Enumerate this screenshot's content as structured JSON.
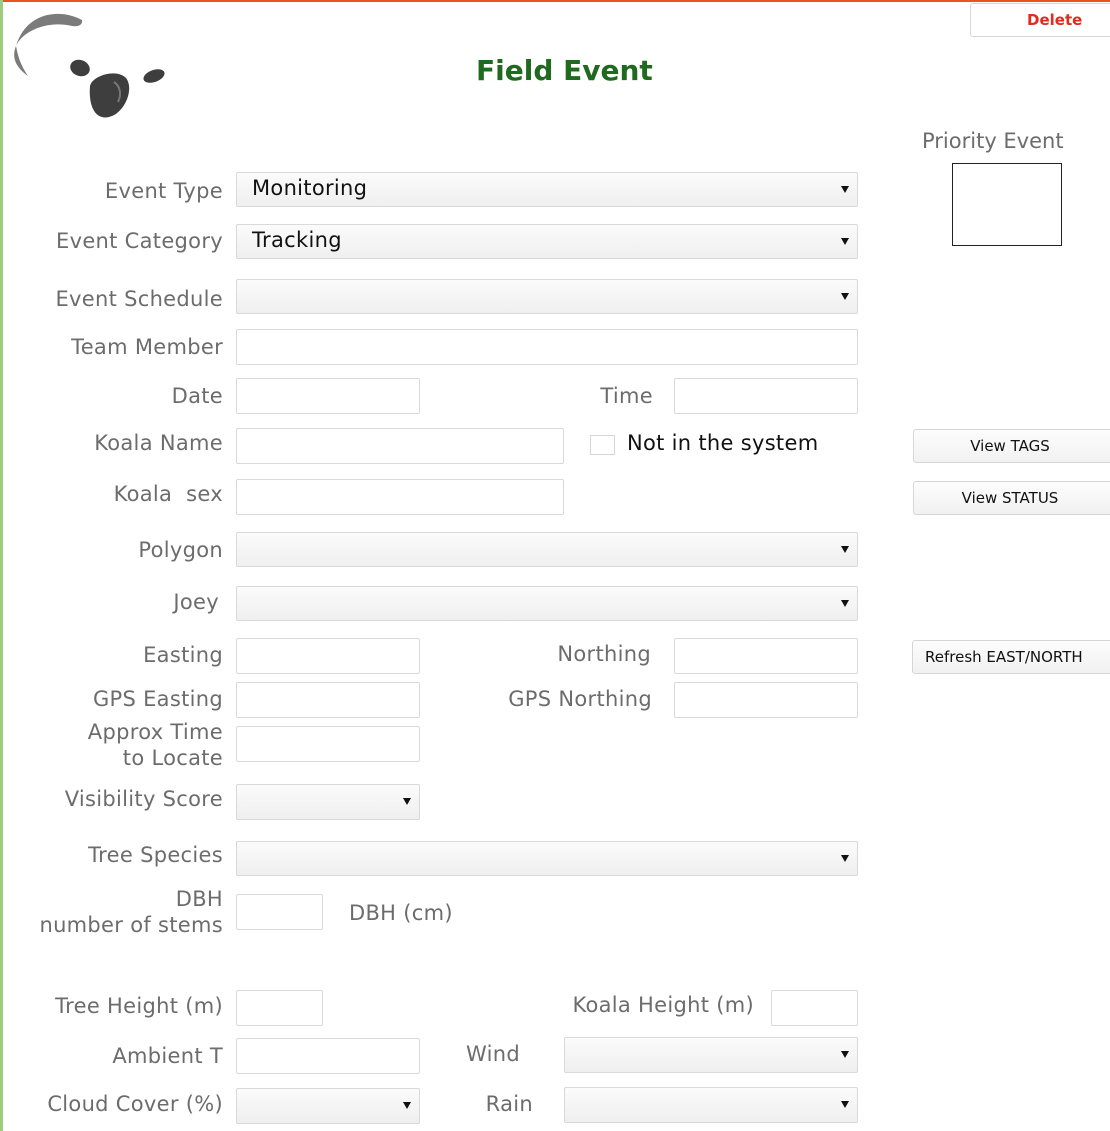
{
  "header": {
    "title": "Field Event",
    "delete_label": "Delete",
    "priority_label": "Priority Event"
  },
  "form": {
    "event_type_label": "Event Type",
    "event_type_value": "Monitoring",
    "event_category_label": "Event Category",
    "event_category_value": "Tracking",
    "event_schedule_label": "Event Schedule",
    "event_schedule_value": "",
    "team_member_label": "Team Member",
    "team_member_value": "",
    "date_label": "Date",
    "date_value": "",
    "time_label": "Time",
    "time_value": "",
    "koala_name_label": "Koala Name",
    "koala_name_value": "",
    "not_in_system_label": "Not in the system",
    "not_in_system_checked": false,
    "koala_sex_label": "Koala  sex",
    "koala_sex_value": "",
    "polygon_label": "Polygon",
    "polygon_value": "",
    "joey_label": "Joey",
    "joey_value": "",
    "easting_label": "Easting",
    "easting_value": "",
    "northing_label": "Northing",
    "northing_value": "",
    "gps_easting_label": "GPS Easting",
    "gps_easting_value": "",
    "gps_northing_label": "GPS Northing",
    "gps_northing_value": "",
    "approx_time_label_1": "Approx Time",
    "approx_time_label_2": "to Locate",
    "approx_time_value": "",
    "visibility_label": "Visibility Score",
    "visibility_value": "",
    "tree_species_label": "Tree Species",
    "tree_species_value": "",
    "dbh_label_1": "DBH",
    "dbh_label_2": "number of stems",
    "dbh_stems_value": "",
    "dbh_cm_label": "DBH (cm)",
    "tree_height_label": "Tree Height (m)",
    "tree_height_value": "",
    "koala_height_label": "Koala Height (m)",
    "koala_height_value": "",
    "ambient_label": "Ambient T",
    "ambient_value": "",
    "wind_label": "Wind",
    "wind_value": "",
    "cloud_label": "Cloud Cover (%)",
    "cloud_value": "",
    "rain_label": "Rain",
    "rain_value": ""
  },
  "side_buttons": {
    "view_tags": "View TAGS",
    "view_status": "View STATUS",
    "refresh": "Refresh EAST/NORTH"
  },
  "colors": {
    "title": "#1f6a1f",
    "delete": "#e02b1e",
    "top_accent": "#e8541e",
    "left_accent": "#9ccc7c"
  }
}
